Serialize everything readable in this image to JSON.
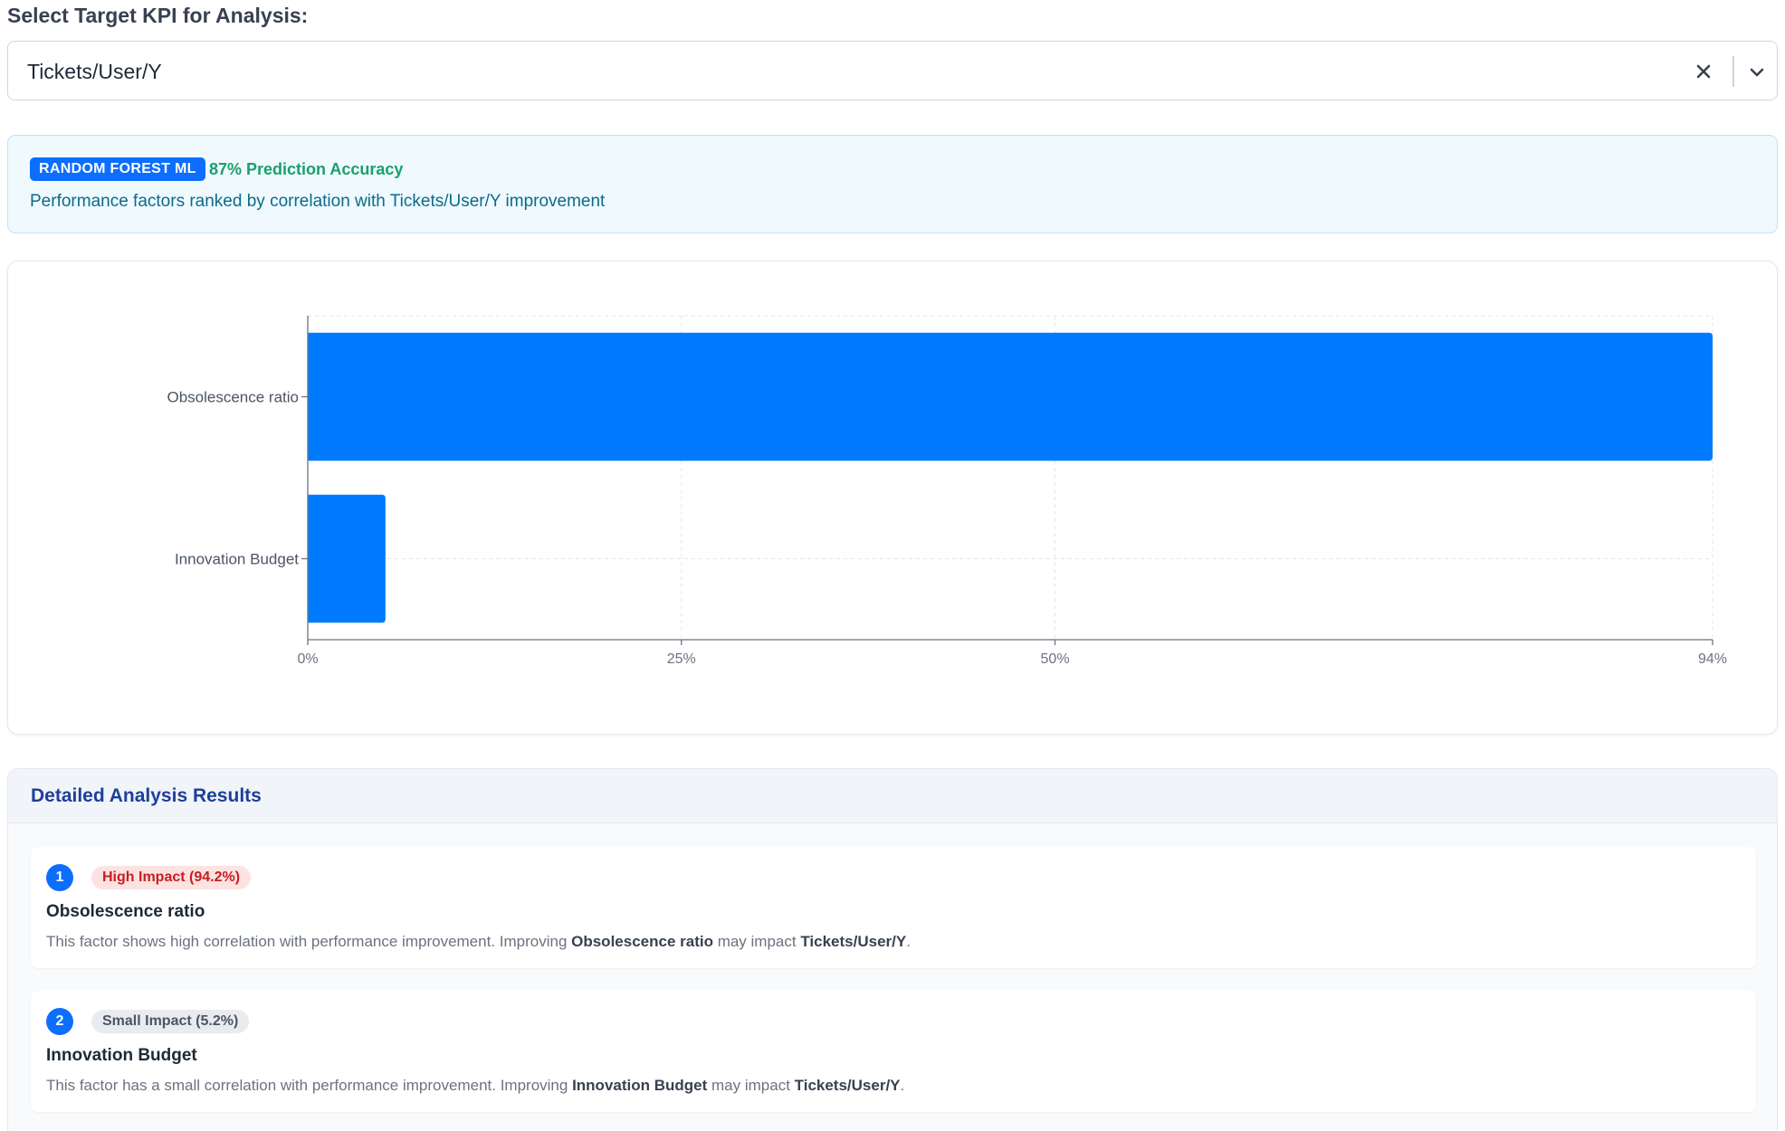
{
  "kpi": {
    "label": "Select Target KPI for Analysis:",
    "selected": "Tickets/User/Y"
  },
  "model": {
    "badge": "RANDOM FOREST ML",
    "accuracy": "87% Prediction Accuracy",
    "description": "Performance factors ranked by correlation with Tickets/User/Y improvement"
  },
  "chart_data": {
    "type": "bar",
    "orientation": "horizontal",
    "categories": [
      "Obsolescence ratio",
      "Innovation Budget"
    ],
    "values": [
      94.2,
      5.2
    ],
    "xticks": [
      0,
      25,
      50,
      94
    ],
    "xtick_labels": [
      "0%",
      "25%",
      "50%",
      "94%"
    ],
    "xlim": [
      0,
      94
    ],
    "grid": true,
    "bar_color": "#007bff"
  },
  "details": {
    "title": "Detailed Analysis Results",
    "items": [
      {
        "rank": "1",
        "impact": "High Impact (94.2%)",
        "name": "Obsolescence ratio",
        "desc_pre": "This factor shows high correlation with performance improvement. Improving ",
        "factor": "Obsolescence ratio",
        "desc_mid": " may impact ",
        "kpi": "Tickets/User/Y",
        "desc_post": "."
      },
      {
        "rank": "2",
        "impact": "Small Impact (5.2%)",
        "name": "Innovation Budget",
        "desc_pre": "This factor has a small correlation with performance improvement. Improving ",
        "factor": "Innovation Budget",
        "desc_mid": " may impact ",
        "kpi": "Tickets/User/Y",
        "desc_post": "."
      }
    ]
  },
  "colors": {
    "accent": "#0d6efd",
    "high_impact_bg": "#fde2e2",
    "high_impact_text": "#c81e1e",
    "accuracy_text": "#1aa06d"
  },
  "icons": {
    "clear": "close-icon",
    "dropdown": "chevron-down-icon"
  }
}
